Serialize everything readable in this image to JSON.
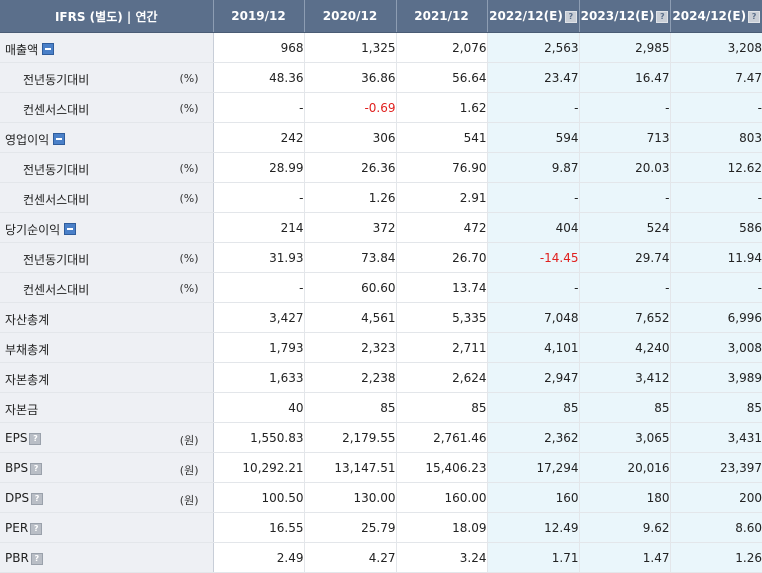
{
  "header": {
    "title": "IFRS (별도) | 연간",
    "periods": [
      "2019/12",
      "2020/12",
      "2021/12",
      "2022/12(E)",
      "2023/12(E)",
      "2024/12(E)"
    ]
  },
  "icons": {
    "help_glyph": "?",
    "toggle": "collapse-minus-icon"
  },
  "colors": {
    "header_bg": "#5b6f8b",
    "label_bg": "#eef0f4",
    "estimate_bg": "#eaf6fb",
    "negative": "#e0201e"
  },
  "rows": [
    {
      "label": "매출액",
      "unit": "",
      "values": [
        "968",
        "1,325",
        "2,076",
        "2,563",
        "2,985",
        "3,208"
      ]
    },
    {
      "label": "전년동기대비",
      "unit": "(%)",
      "values": [
        "48.36",
        "36.86",
        "56.64",
        "23.47",
        "16.47",
        "7.47"
      ]
    },
    {
      "label": "컨센서스대비",
      "unit": "(%)",
      "values": [
        "-",
        "-0.69",
        "1.62",
        "-",
        "-",
        "-"
      ]
    },
    {
      "label": "영업이익",
      "unit": "",
      "values": [
        "242",
        "306",
        "541",
        "594",
        "713",
        "803"
      ]
    },
    {
      "label": "전년동기대비",
      "unit": "(%)",
      "values": [
        "28.99",
        "26.36",
        "76.90",
        "9.87",
        "20.03",
        "12.62"
      ]
    },
    {
      "label": "컨센서스대비",
      "unit": "(%)",
      "values": [
        "-",
        "1.26",
        "2.91",
        "-",
        "-",
        "-"
      ]
    },
    {
      "label": "당기순이익",
      "unit": "",
      "values": [
        "214",
        "372",
        "472",
        "404",
        "524",
        "586"
      ]
    },
    {
      "label": "전년동기대비",
      "unit": "(%)",
      "values": [
        "31.93",
        "73.84",
        "26.70",
        "-14.45",
        "29.74",
        "11.94"
      ]
    },
    {
      "label": "컨센서스대비",
      "unit": "(%)",
      "values": [
        "-",
        "60.60",
        "13.74",
        "-",
        "-",
        "-"
      ]
    },
    {
      "label": "자산총계",
      "unit": "",
      "values": [
        "3,427",
        "4,561",
        "5,335",
        "7,048",
        "7,652",
        "6,996"
      ]
    },
    {
      "label": "부채총계",
      "unit": "",
      "values": [
        "1,793",
        "2,323",
        "2,711",
        "4,101",
        "4,240",
        "3,008"
      ]
    },
    {
      "label": "자본총계",
      "unit": "",
      "values": [
        "1,633",
        "2,238",
        "2,624",
        "2,947",
        "3,412",
        "3,989"
      ]
    },
    {
      "label": "자본금",
      "unit": "",
      "values": [
        "40",
        "85",
        "85",
        "85",
        "85",
        "85"
      ]
    },
    {
      "label": "EPS",
      "unit": "(원)",
      "values": [
        "1,550.83",
        "2,179.55",
        "2,761.46",
        "2,362",
        "3,065",
        "3,431"
      ]
    },
    {
      "label": "BPS",
      "unit": "(원)",
      "values": [
        "10,292.21",
        "13,147.51",
        "15,406.23",
        "17,294",
        "20,016",
        "23,397"
      ]
    },
    {
      "label": "DPS",
      "unit": "(원)",
      "values": [
        "100.50",
        "130.00",
        "160.00",
        "160",
        "180",
        "200"
      ]
    },
    {
      "label": "PER",
      "unit": "",
      "values": [
        "16.55",
        "25.79",
        "18.09",
        "12.49",
        "9.62",
        "8.60"
      ]
    },
    {
      "label": "PBR",
      "unit": "",
      "values": [
        "2.49",
        "4.27",
        "3.24",
        "1.71",
        "1.47",
        "1.26"
      ]
    }
  ]
}
